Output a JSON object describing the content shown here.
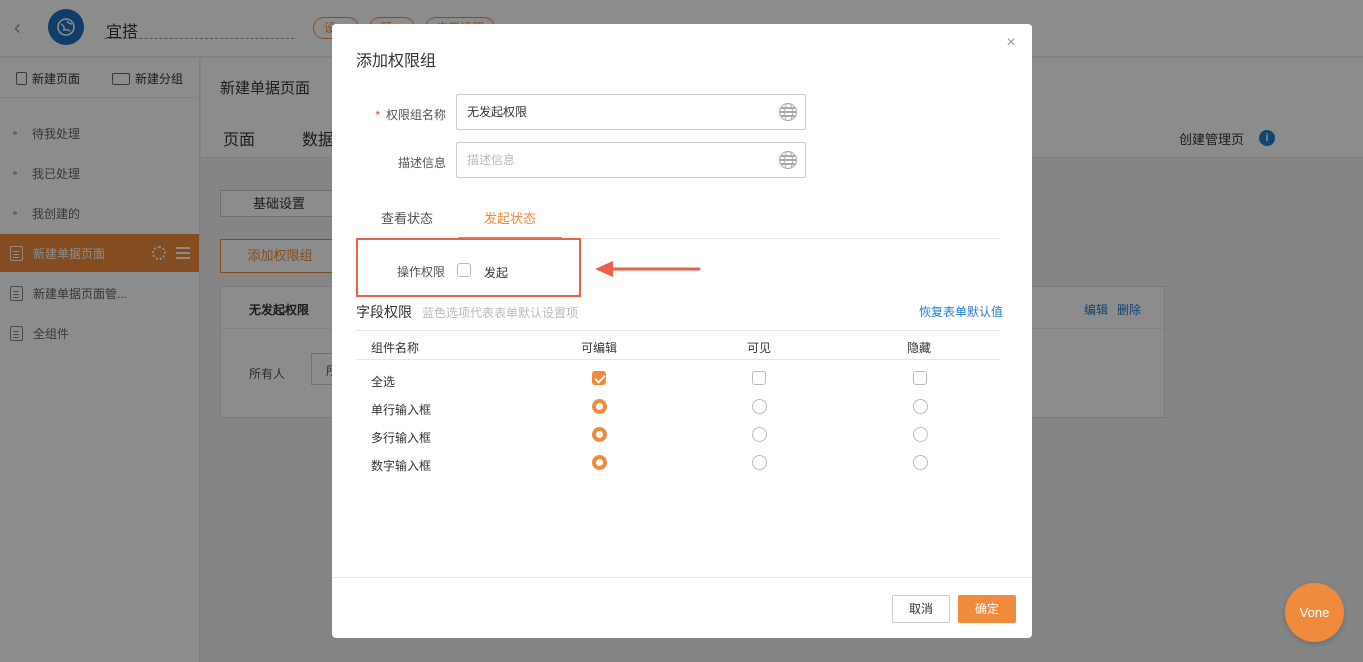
{
  "app": {
    "name": "宜搭",
    "pills": [
      "设…",
      "预…",
      "应用设置"
    ]
  },
  "sidebar": {
    "new_page": "新建页面",
    "new_group": "新建分组",
    "items": [
      {
        "label": "待我处理"
      },
      {
        "label": "我已处理"
      },
      {
        "label": "我创建的"
      },
      {
        "label": "新建单据页面"
      },
      {
        "label": "新建单据页面管..."
      },
      {
        "label": "全组件"
      }
    ]
  },
  "main": {
    "title": "新建单据页面",
    "tabs": [
      "页面",
      "数据"
    ],
    "create_admin": "创建管理页",
    "basic_settings": "基础设置",
    "add_group": "添加权限组",
    "card_name": "无发起权限",
    "edit": "编辑",
    "delete": "删除",
    "everyone": "所有人",
    "select_stub": "所"
  },
  "modal": {
    "title": "添加权限组",
    "close": "×",
    "name_label": "权限组名称",
    "required_mark": "*",
    "name_value": "无发起权限",
    "desc_label": "描述信息",
    "desc_placeholder": "描述信息",
    "tabs": [
      "查看状态",
      "发起状态"
    ],
    "op_label": "操作权限",
    "op_option": "发起",
    "field_title": "字段权限",
    "field_hint": "蓝色选项代表表单默认设置项",
    "reset": "恢复表单默认值",
    "columns": [
      "组件名称",
      "可编辑",
      "可见",
      "隐藏"
    ],
    "rows": [
      {
        "name": "全选",
        "selected": "可编辑"
      },
      {
        "name": "单行输入框",
        "selected": "可编辑"
      },
      {
        "name": "多行输入框",
        "selected": "可编辑"
      },
      {
        "name": "数字输入框",
        "selected": "可编辑"
      }
    ],
    "cancel": "取消",
    "ok": "确定"
  },
  "vone": "Vone",
  "colors": {
    "accent": "#f08a3c",
    "link": "#1e7cd6",
    "highlight": "#ee5f4a"
  }
}
